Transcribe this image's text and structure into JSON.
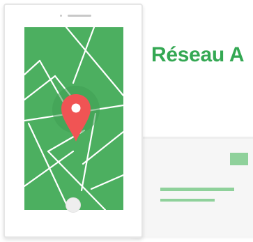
{
  "headline": {
    "text": "Réseau A"
  },
  "colors": {
    "brand_green": "#34a853",
    "map_green": "#4caf60",
    "pin_red": "#f05454",
    "accent_light_green": "#8fd19b"
  },
  "icons": {
    "pin": "map-pin-icon"
  }
}
